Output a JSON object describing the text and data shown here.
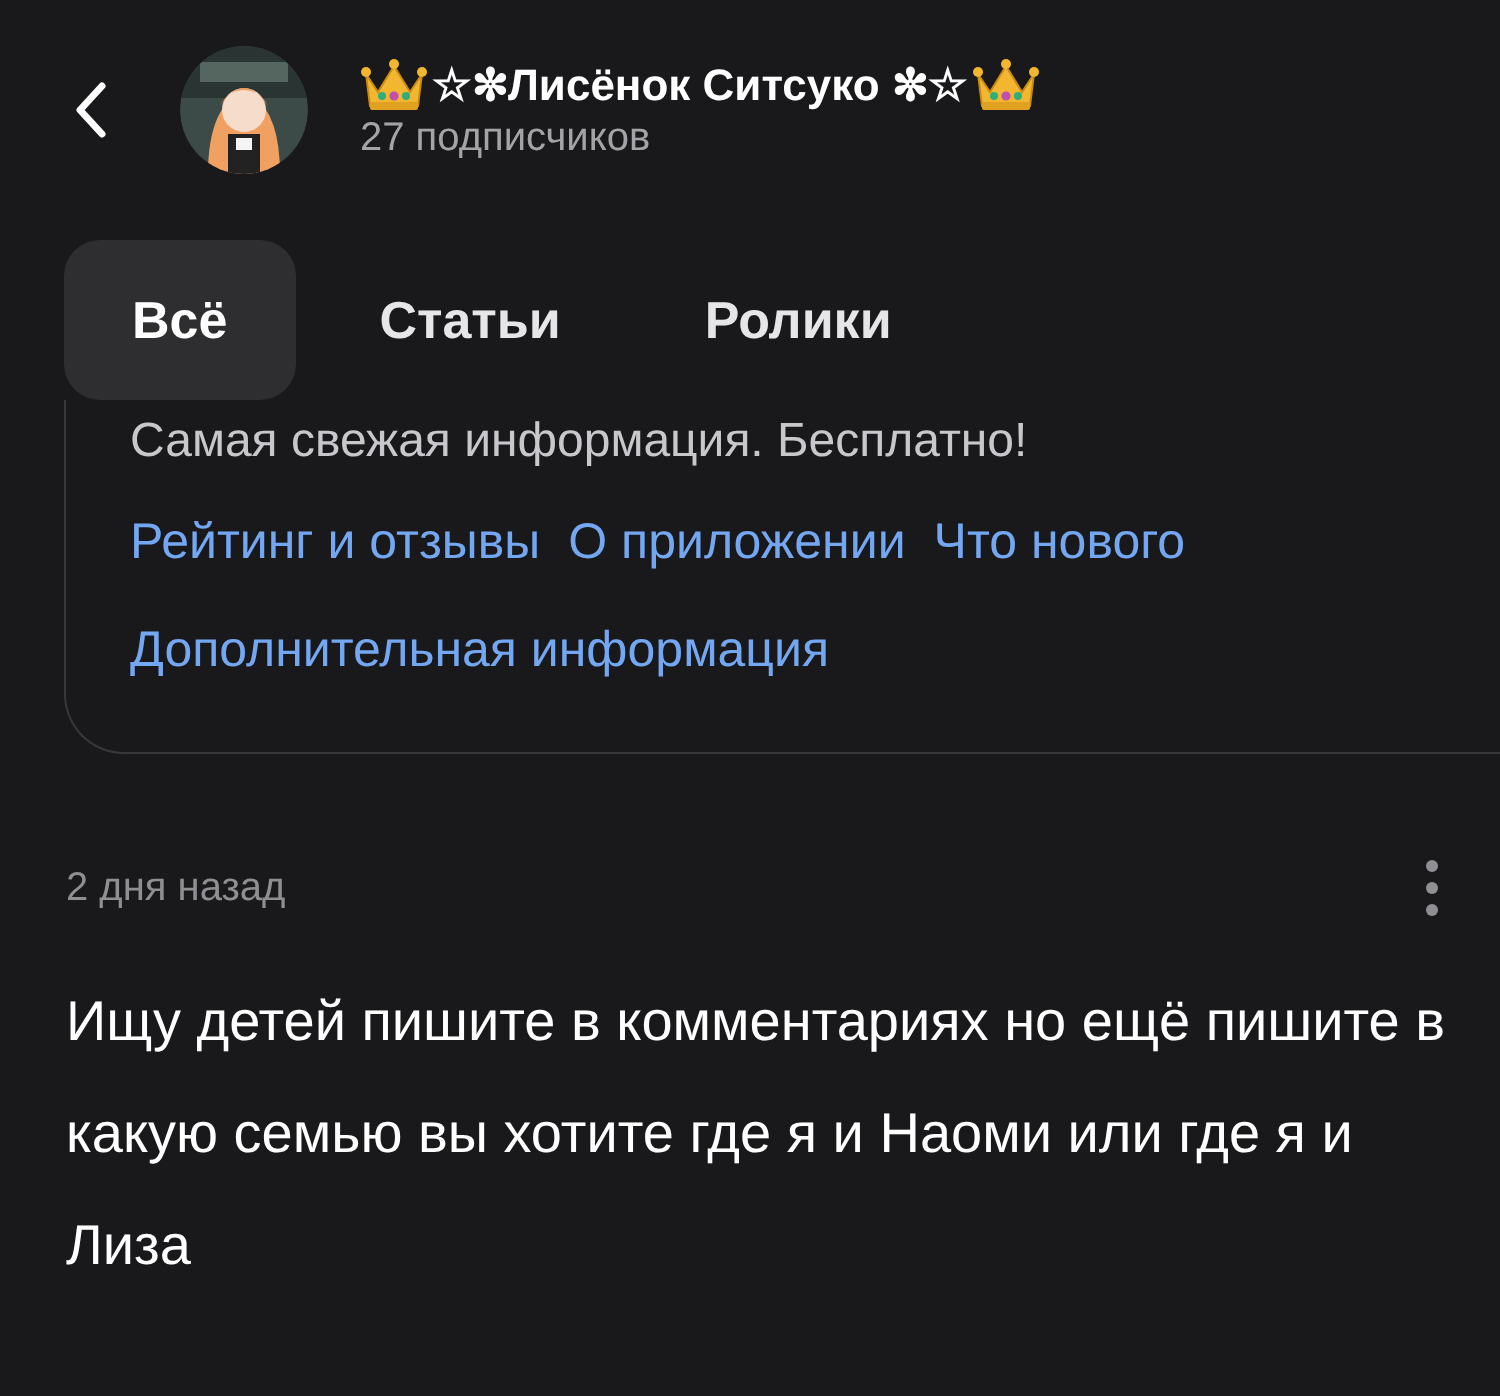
{
  "header": {
    "title": "☆✼Лисёнок Ситсуко ✼☆",
    "subscribers": "27 подписчиков"
  },
  "tabs": [
    {
      "label": "Всё",
      "selected": true
    },
    {
      "label": "Статьи",
      "selected": false
    },
    {
      "label": "Ролики",
      "selected": false
    }
  ],
  "card": {
    "tagline": "Самая свежая информация. Бесплатно!",
    "links": [
      "Рейтинг и отзывы",
      "О приложении",
      "Что нового",
      "Дополнительная информация"
    ]
  },
  "post": {
    "time": "2 дня назад",
    "text": "Ищу детей пишите в комментариях но ещё пишите в какую семью вы хотите где я и Наоми или где я и Лиза"
  }
}
